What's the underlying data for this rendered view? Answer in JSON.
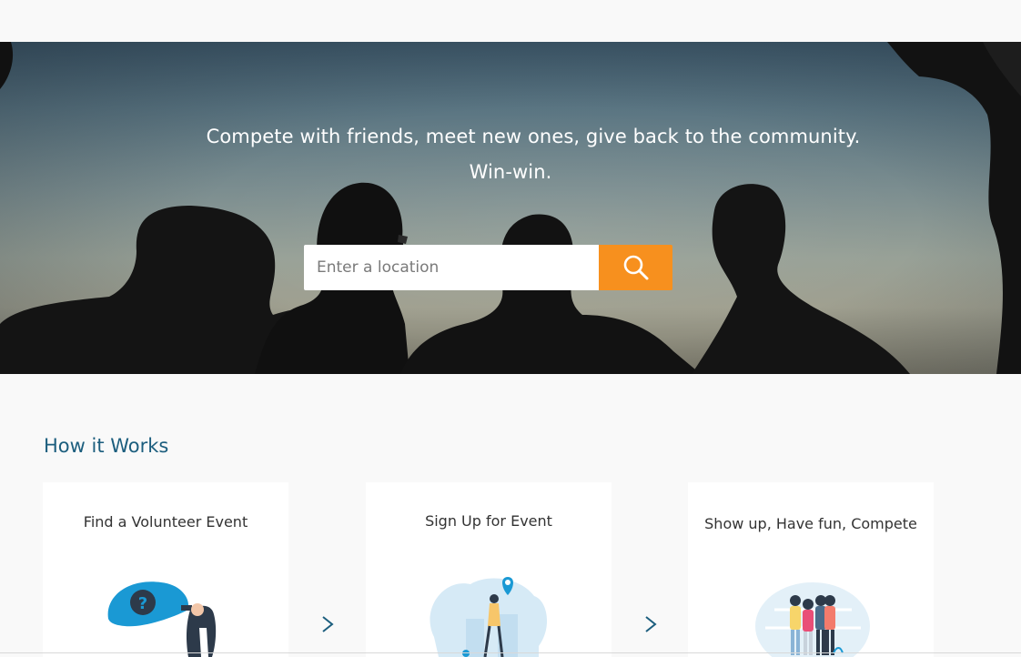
{
  "hero": {
    "tagline_line1": "Compete with friends, meet new ones, give back to the community.",
    "tagline_line2": "Win-win.",
    "search": {
      "placeholder": "Enter a location",
      "button_icon": "search-icon"
    }
  },
  "how_it_works": {
    "title": "How it Works",
    "steps": [
      {
        "label": "Find a Volunteer Event",
        "icon": "search-event-illustration"
      },
      {
        "label": "Sign Up for Event",
        "icon": "map-pin-illustration"
      },
      {
        "label": "Show up, Have fun, Compete",
        "icon": "group-illustration"
      }
    ],
    "arrow_icon": "chevron-right-icon"
  },
  "colors": {
    "accent": "#f7901e",
    "title": "#1c5e7e",
    "background": "#f9f9f9"
  }
}
